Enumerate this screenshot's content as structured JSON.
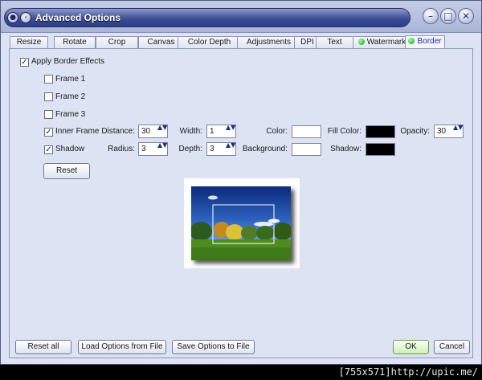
{
  "window": {
    "title": "Advanced Options"
  },
  "titlebar_buttons": {
    "menu_glyph": "●",
    "restore_glyph": "‹",
    "minimize": "–",
    "maximize": "□",
    "close": "✕"
  },
  "tabs": [
    {
      "label": "Resize"
    },
    {
      "label": "Rotate"
    },
    {
      "label": "Crop"
    },
    {
      "label": "Canvas"
    },
    {
      "label": "Color Depth"
    },
    {
      "label": "Adjustments"
    },
    {
      "label": "DPI"
    },
    {
      "label": "Text"
    },
    {
      "label": "Watermark",
      "indicator": "green-led-icon"
    },
    {
      "label": "Border",
      "indicator": "green-led-icon",
      "active": true
    }
  ],
  "border": {
    "apply_label": "Apply Border Effects",
    "apply_checked": true,
    "frame1_label": "Frame 1",
    "frame1_checked": false,
    "frame2_label": "Frame 2",
    "frame2_checked": false,
    "frame3_label": "Frame 3",
    "frame3_checked": false,
    "inner_frame_label": "Inner Frame",
    "inner_frame_checked": true,
    "shadow_label": "Shadow",
    "shadow_checked": true,
    "check_glyph": "✓",
    "distance_label": "Distance:",
    "distance_value": "30",
    "width_label": "Width:",
    "width_value": "1",
    "color_label": "Color:",
    "color_value": "#ffffff",
    "fill_color_label": "Fill Color:",
    "fill_color_value": "#000000",
    "opacity_label": "Opacity:",
    "opacity_value": "30",
    "radius_label": "Radius:",
    "radius_value": "3",
    "depth_label": "Depth:",
    "depth_value": "3",
    "background_label": "Background:",
    "background_value": "#ffffff",
    "shadow_color_label": "Shadow:",
    "shadow_color_value": "#000000",
    "reset_label": "Reset",
    "spin_glyph": "▲▼"
  },
  "footer": {
    "reset_all": "Reset all",
    "load_options": "Load Options from File",
    "save_options": "Save Options to File",
    "ok": "OK",
    "cancel": "Cancel"
  },
  "statusbar": {
    "credit": "[755x571]http://upic.me/"
  }
}
